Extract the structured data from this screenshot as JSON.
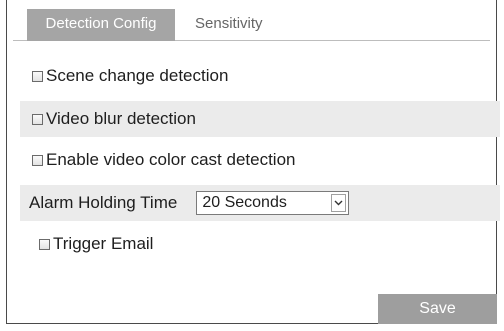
{
  "tabs": {
    "detection_config": "Detection Config",
    "sensitivity": "Sensitivity"
  },
  "options": {
    "scene_change": {
      "label": "Scene change detection",
      "checked": false
    },
    "video_blur": {
      "label": "Video blur detection",
      "checked": false
    },
    "color_cast": {
      "label": "Enable video color cast detection",
      "checked": false
    }
  },
  "alarm": {
    "label": "Alarm Holding Time",
    "value": "20 Seconds"
  },
  "trigger": {
    "email_label": "Trigger Email",
    "email_checked": false
  },
  "actions": {
    "save_label": "Save"
  },
  "colors": {
    "active_tab_bg": "#a5a5a5",
    "row_shade": "#ebebeb",
    "save_bg": "#9e9e9e"
  },
  "icons": {
    "dropdown": "chevron-down-icon"
  }
}
